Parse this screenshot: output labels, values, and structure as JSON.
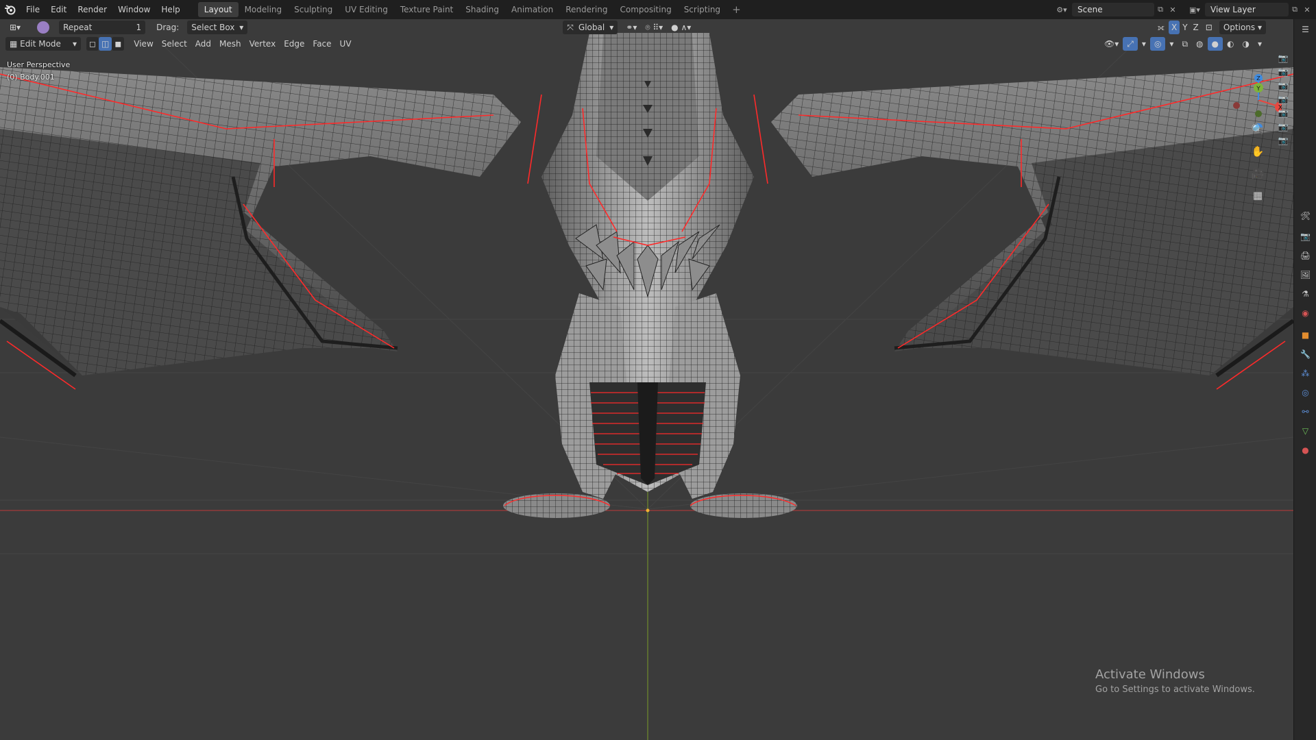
{
  "menu": [
    "File",
    "Edit",
    "Render",
    "Window",
    "Help"
  ],
  "workspaces": [
    "Layout",
    "Modeling",
    "Sculpting",
    "UV Editing",
    "Texture Paint",
    "Shading",
    "Animation",
    "Rendering",
    "Compositing",
    "Scripting"
  ],
  "active_workspace": "Layout",
  "scene": {
    "label": "Scene",
    "view_layer": "View Layer"
  },
  "tool_header": {
    "repeat_label": "Repeat",
    "repeat_value": "1",
    "drag_label": "Drag:",
    "drag_value": "Select Box",
    "orientation": "Global",
    "options_label": "Options",
    "axes": [
      "X",
      "Y",
      "Z"
    ]
  },
  "viewport_header": {
    "mode": "Edit Mode",
    "menus": [
      "View",
      "Select",
      "Add",
      "Mesh",
      "Vertex",
      "Edge",
      "Face",
      "UV"
    ]
  },
  "viewport_info": {
    "perspective": "User Perspective",
    "object": "(0) Body.001"
  },
  "gizmo_axes": {
    "x": "X",
    "y": "Y",
    "z": "Z"
  },
  "watermark": {
    "title": "Activate Windows",
    "subtitle": "Go to Settings to activate Windows."
  },
  "colors": {
    "seam": "#ff2a2a",
    "axis_x": "#e8473f",
    "axis_y": "#7fb33a",
    "axis_z": "#3f8be0",
    "accent": "#4772b3"
  },
  "icons": {
    "right_panel": [
      "tool-icon",
      "render-icon",
      "output-icon",
      "view-layer-icon",
      "scene-icon",
      "world-icon",
      "object-icon",
      "modifier-icon",
      "particles-icon",
      "physics-icon",
      "constraints-icon",
      "data-icon",
      "material-icon"
    ]
  }
}
